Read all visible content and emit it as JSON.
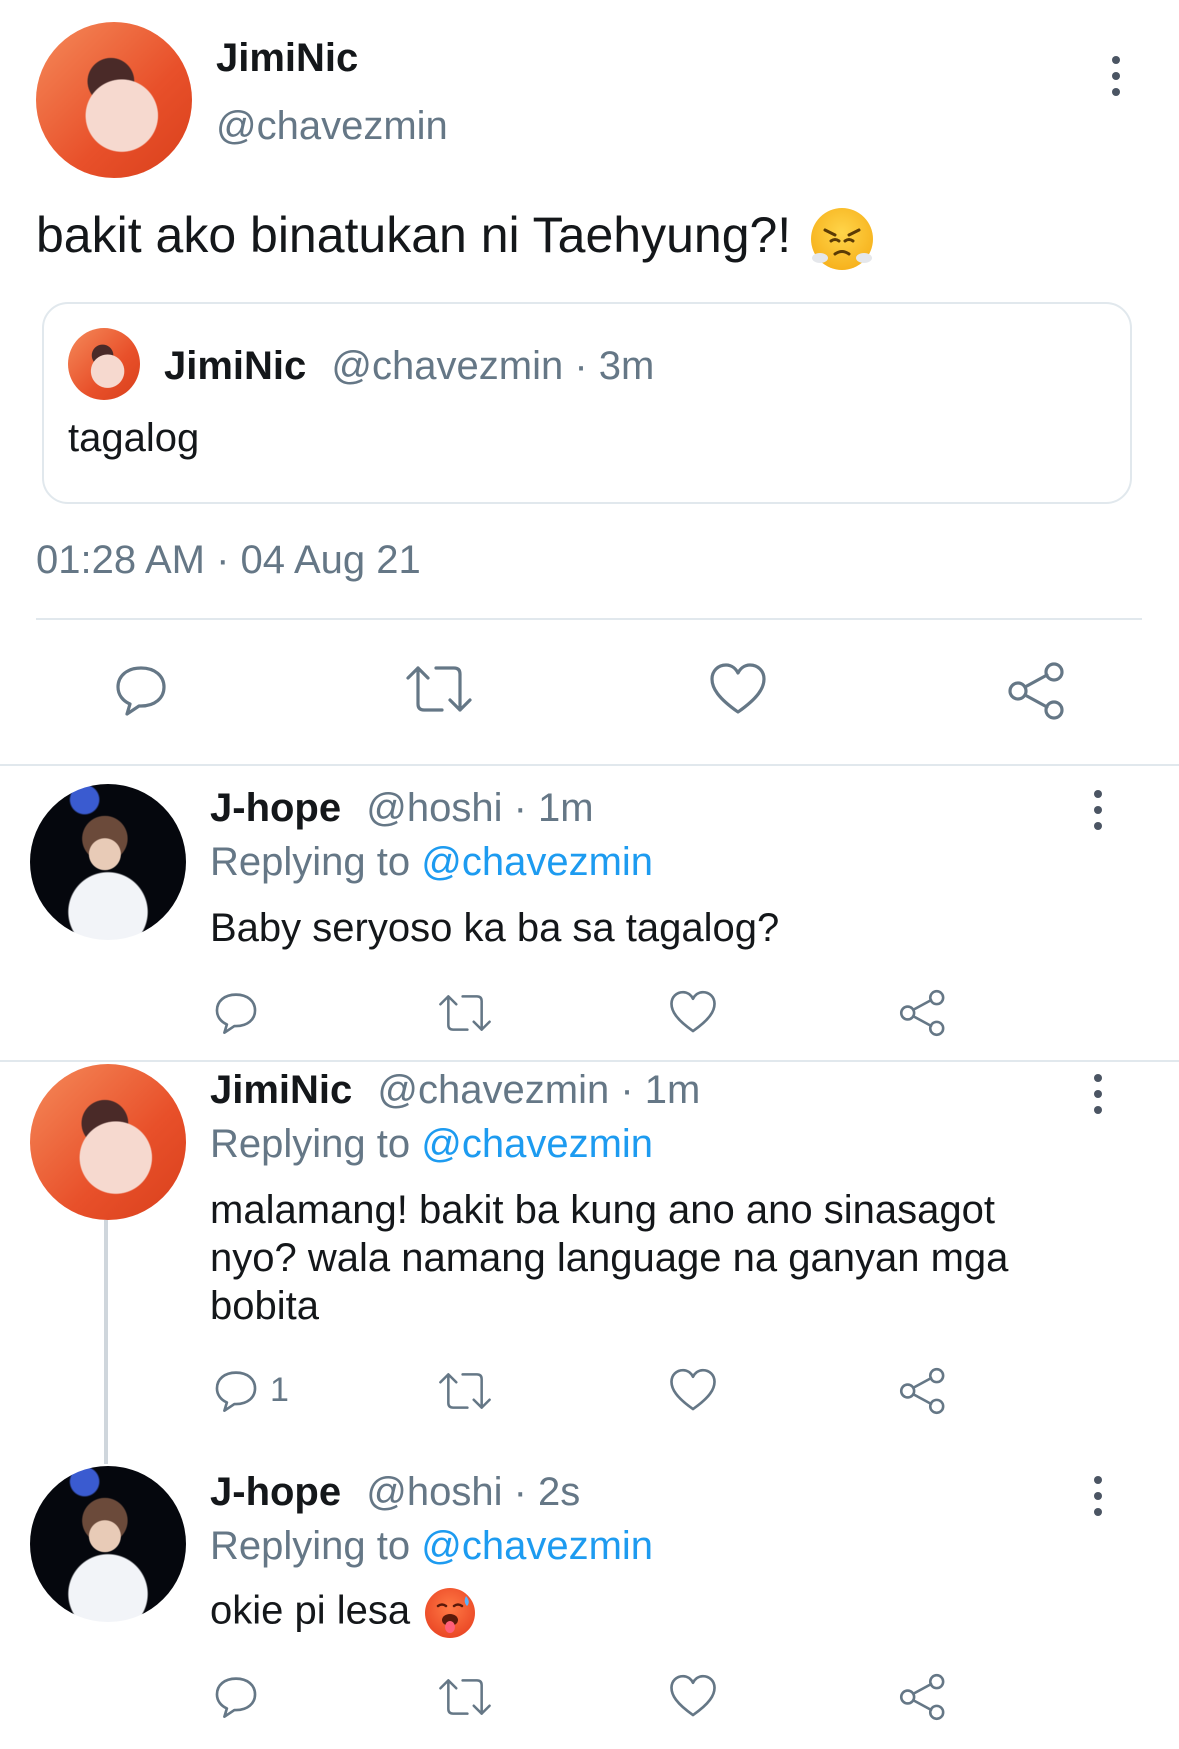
{
  "main_tweet": {
    "author_name": "JimiNic",
    "handle": "@chavezmin",
    "text": "bakit ako binatukan ni Taehyung?!",
    "emoji": "😤",
    "quoted": {
      "author_name": "JimiNic",
      "handle": "@chavezmin",
      "time": "· 3m",
      "text": "tagalog"
    },
    "timestamp": "01:28 AM · 04 Aug 21"
  },
  "replies": [
    {
      "author_name": "J-hope",
      "handle": "@hoshi",
      "time": "· 1m",
      "replying_prefix": "Replying to",
      "replying_handle": "@chavezmin",
      "text": "Baby seryoso ka ba sa tagalog?",
      "reply_count": ""
    },
    {
      "author_name": "JimiNic",
      "handle": "@chavezmin",
      "time": "· 1m",
      "replying_prefix": "Replying to",
      "replying_handle": "@chavezmin",
      "text": "malamang! bakit ba kung ano ano sinasagot nyo? wala namang language na ganyan mga bobita",
      "reply_count": "1"
    },
    {
      "author_name": "J-hope",
      "handle": "@hoshi",
      "time": "· 2s",
      "replying_prefix": "Replying to",
      "replying_handle": "@chavezmin",
      "text": "okie pi lesa",
      "emoji": "🥵",
      "reply_count": ""
    }
  ],
  "icons": [
    "reply-icon",
    "retweet-icon",
    "like-icon",
    "share-icon",
    "more-icon"
  ],
  "colors": {
    "link_blue": "#1d9bf0",
    "secondary_grey": "#657786",
    "border": "#e1e8ed"
  }
}
